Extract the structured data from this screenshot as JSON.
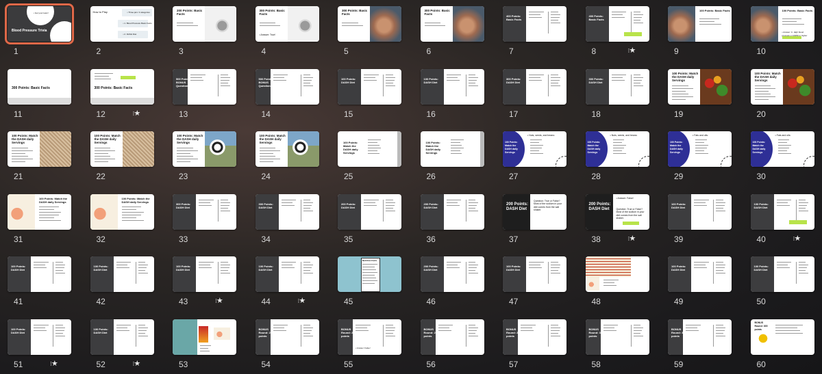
{
  "selected": 1,
  "slides": [
    {
      "n": "1",
      "layout": "title",
      "title": "Blood Pressure Trivia",
      "sub": "• Get your team!"
    },
    {
      "n": "2",
      "layout": "howto",
      "title": "How to Play",
      "items": [
        "• Three jars: 3 categories",
        "• 1. Blood Pressure Basic Facts",
        "• 2. DASH Diet"
      ]
    },
    {
      "n": "3",
      "layout": "photo-right",
      "title": "200 Points: Basic Facts",
      "photo": "steth"
    },
    {
      "n": "4",
      "layout": "photo-right",
      "title": "300 Points: Basic Facts",
      "answer": "• Answer: True!",
      "photo": "steth"
    },
    {
      "n": "5",
      "layout": "photo-right",
      "title": "300 Points: Basic Facts",
      "photo": "hands"
    },
    {
      "n": "6",
      "layout": "photo-right",
      "title": "300 Points: Basic Facts",
      "photo": "hands"
    },
    {
      "n": "7",
      "layout": "dark-panel",
      "title": "400 Points: Basic Facts"
    },
    {
      "n": "8",
      "layout": "dark-panel",
      "title": "400 Points: Basic Facts",
      "highlight": true,
      "mark": "star"
    },
    {
      "n": "9",
      "layout": "photo-left",
      "title": "100 Points: Basic Facts",
      "photo": "hands"
    },
    {
      "n": "10",
      "layout": "photo-left",
      "title": "100 Points: Basic Facts",
      "answer": "• Answer: C. High blood pressure ≥ 140/90 or higher",
      "highlight": true,
      "photo": "hands"
    },
    {
      "n": "11",
      "layout": "band",
      "title": "300 Points: Basic Facts"
    },
    {
      "n": "12",
      "layout": "band",
      "title": "300 Points: Basic Facts",
      "highlight": true,
      "mark": "star"
    },
    {
      "n": "13",
      "layout": "dark-panel",
      "title": "500 Points: BONUS Question"
    },
    {
      "n": "14",
      "layout": "dark-panel",
      "title": "500 Points: BONUS Question"
    },
    {
      "n": "15",
      "layout": "dark-panel",
      "title": "100 Points: DASH Diet"
    },
    {
      "n": "16",
      "layout": "dark-panel",
      "title": "100 Points: DASH Diet"
    },
    {
      "n": "17",
      "layout": "dark-panel",
      "title": "300 Points: DASH Diet"
    },
    {
      "n": "18",
      "layout": "dark-panel",
      "title": "300 Points: DASH Diet"
    },
    {
      "n": "19",
      "layout": "photo-right",
      "title": "100 Points: Match the DASH daily Servings",
      "photo": "veg"
    },
    {
      "n": "20",
      "layout": "photo-right",
      "title": "100 Points: Match the DASH daily Servings",
      "photo": "veg"
    },
    {
      "n": "21",
      "layout": "photo-right",
      "title": "100 Points: Match the DASH daily Servings",
      "photo": "grain"
    },
    {
      "n": "22",
      "layout": "photo-right",
      "title": "100 Points: Match the DASH daily Servings",
      "photo": "grain"
    },
    {
      "n": "23",
      "layout": "photo-right",
      "title": "100 Points: Match the DASH daily Servings",
      "photo": "cows"
    },
    {
      "n": "24",
      "layout": "photo-right",
      "title": "100 Points: Match the DASH daily Servings",
      "photo": "cows"
    },
    {
      "n": "25",
      "layout": "gray-edge",
      "title": "100 Points: Match the DASH daily Servings"
    },
    {
      "n": "26",
      "layout": "gray-edge",
      "title": "100 Points: Match the DASH daily Servings"
    },
    {
      "n": "27",
      "layout": "circle",
      "title": "100 Points: Match the DASH daily Servings",
      "sub": "• Nuts, seeds, and beans:"
    },
    {
      "n": "28",
      "layout": "circle",
      "title": "100 Points: Match the DASH daily Servings",
      "sub": "• Nuts, seeds, and beans:"
    },
    {
      "n": "29",
      "layout": "circle",
      "title": "100 Points: Match the DASH daily Servings",
      "sub": "• Fats and oils:"
    },
    {
      "n": "30",
      "layout": "circle",
      "title": "100 Points: Match the DASH daily Servings",
      "sub": "• Fats and oils:"
    },
    {
      "n": "31",
      "layout": "photo-left",
      "title": "100 Points: Match the DASH daily Servings",
      "photo": "salmon"
    },
    {
      "n": "32",
      "layout": "photo-left",
      "title": "100 Points: Match the DASH daily Servings",
      "photo": "salmon"
    },
    {
      "n": "33",
      "layout": "dark-panel",
      "title": "300 Points: DASH Diet"
    },
    {
      "n": "34",
      "layout": "dark-panel",
      "title": "300 Points: DASH Diet"
    },
    {
      "n": "35",
      "layout": "dark-panel",
      "title": "200 Points: DASH Diet"
    },
    {
      "n": "36",
      "layout": "dark-panel",
      "title": "200 Points: DASH Diet"
    },
    {
      "n": "37",
      "layout": "big-dark",
      "title": "200 Points: DASH Diet",
      "question": "Question: True or False? Most of the sodium in your diet comes from the salt shaker."
    },
    {
      "n": "38",
      "layout": "big-dark",
      "title": "200 Points: DASH Diet",
      "answer": "• Answer: False!",
      "question": "Question: True or False? Most of the sodium in your diet comes from the salt shaker.",
      "highlight": true,
      "mark": "star"
    },
    {
      "n": "39",
      "layout": "dark-panel",
      "title": "100 Points: DASH Diet"
    },
    {
      "n": "40",
      "layout": "dark-panel",
      "title": "100 Points: DASH Diet",
      "highlight": true,
      "mark": "star"
    },
    {
      "n": "41",
      "layout": "dark-panel",
      "title": "100 Points: DASH Diet"
    },
    {
      "n": "42",
      "layout": "dark-panel",
      "title": "100 Points: DASH Diet"
    },
    {
      "n": "43",
      "layout": "dark-panel",
      "title": "100 Points: DASH Diet",
      "mark": "star"
    },
    {
      "n": "44",
      "layout": "dark-panel",
      "title": "100 Points: DASH Diet",
      "mark": "star"
    },
    {
      "n": "45",
      "layout": "label",
      "title": "Nutrition Facts"
    },
    {
      "n": "46",
      "layout": "dark-panel",
      "title": "200 Points: DASH Diet"
    },
    {
      "n": "47",
      "layout": "dark-panel",
      "title": "100 Points: DASH Diet"
    },
    {
      "n": "48",
      "layout": "table",
      "title": ""
    },
    {
      "n": "49",
      "layout": "dark-panel",
      "title": "100 Points: DASH Diet"
    },
    {
      "n": "50",
      "layout": "dark-panel",
      "title": "100 Points: DASH Diet"
    },
    {
      "n": "51",
      "layout": "dark-panel",
      "title": "100 Points: DASH Diet",
      "mark": "star"
    },
    {
      "n": "52",
      "layout": "dark-panel",
      "title": "100 Points: DASH Diet",
      "mark": "star"
    },
    {
      "n": "53",
      "layout": "photos",
      "title": ""
    },
    {
      "n": "54",
      "layout": "dark-panel",
      "title": "BONUS Round: 200 points"
    },
    {
      "n": "55",
      "layout": "dark-panel",
      "title": "BONUS Round: 200 points",
      "answer": "• Answer: False!"
    },
    {
      "n": "56",
      "layout": "dark-panel",
      "title": "BONUS Round: 200 points"
    },
    {
      "n": "57",
      "layout": "dark-panel",
      "title": "BONUS Round: 200 points"
    },
    {
      "n": "58",
      "layout": "dark-panel",
      "title": "BONUS Round: 300 points"
    },
    {
      "n": "59",
      "layout": "dark-panel",
      "title": "BONUS Round: 300 points"
    },
    {
      "n": "60",
      "layout": "bonus-last",
      "title": "BONUS Round: 300 points"
    }
  ],
  "colors": {
    "accent": "#e06848",
    "dark": "#3d3d3f",
    "purple": "#2e2f96",
    "highlight": "#b8e34a",
    "teal": "#8ec3cf"
  },
  "icons": {
    "star": "star-icon",
    "dots": "transition-dots-icon"
  }
}
